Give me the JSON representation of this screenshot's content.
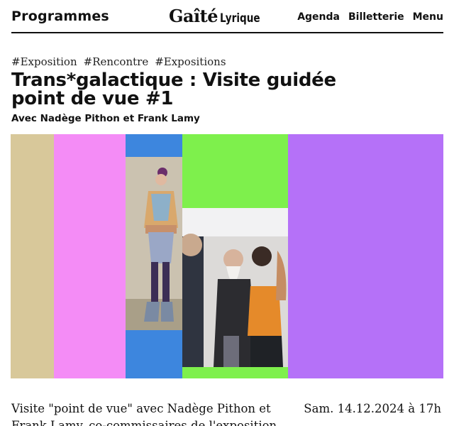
{
  "header": {
    "programmes": "Programmes",
    "logo_main": "Gaîté",
    "logo_sub": "Lyrique",
    "nav": [
      "Agenda",
      "Billetterie",
      "Menu"
    ]
  },
  "tags": [
    "#Exposition",
    "#Rencontre",
    "#Expositions"
  ],
  "event": {
    "title_line1": "Trans*galactique : Visite guidée",
    "title_line2": "point de vue #1",
    "subtitle": "Avec Nadège Pithon et Frank Lamy",
    "description_line1": "Visite \"point de vue\" avec Nadège Pithon et",
    "description_line2": "Frank Lamy, co-commissaires de l'exposition",
    "date": "Sam. 14.12.2024 à 17h"
  },
  "colors": {
    "beige": "#d8c89a",
    "pink": "#f48cf6",
    "blue": "#3d86de",
    "green": "#7ef04c",
    "purple": "#b571f8"
  }
}
